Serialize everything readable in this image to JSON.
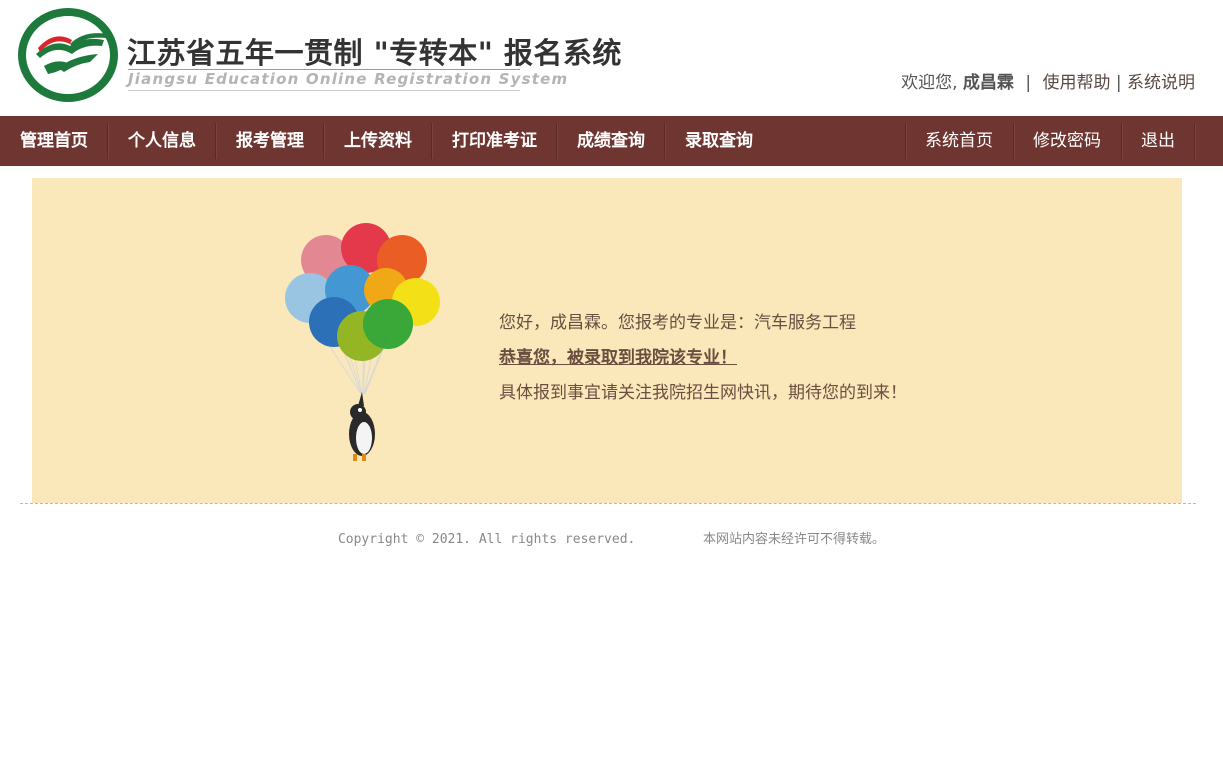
{
  "header": {
    "title_cn": "江苏省五年一贯制 \"专转本\" 报名系统",
    "title_en": "Jiangsu Education Online Registration System",
    "welcome_prefix": "欢迎您,",
    "user_name": "成昌霖",
    "separator": "|",
    "help_link": "使用帮助",
    "help_sep": "|",
    "about_link": "系统说明",
    "logo_icon": "green-circle-book-logo",
    "accent_color": "#6f3530"
  },
  "nav": {
    "left": [
      {
        "label": "管理首页"
      },
      {
        "label": "个人信息"
      },
      {
        "label": "报考管理"
      },
      {
        "label": "上传资料"
      },
      {
        "label": "打印准考证"
      },
      {
        "label": "成绩查询"
      },
      {
        "label": "录取查询"
      }
    ],
    "right": [
      {
        "label": "系统首页"
      },
      {
        "label": "修改密码"
      },
      {
        "label": "退出"
      }
    ]
  },
  "notice": {
    "line1": "您好，成昌霖。您报考的专业是：汽车服务工程",
    "line2": "恭喜您，被录取到我院该专业！",
    "line3": "具体报到事宜请关注我院招生网快讯，期待您的到来！",
    "illustration": "penguin-with-balloons",
    "panel_color": "#fae8bb"
  },
  "footer": {
    "copyright": "Copyright © 2021. All rights reserved.",
    "notice": "本网站内容未经许可不得转载。"
  }
}
